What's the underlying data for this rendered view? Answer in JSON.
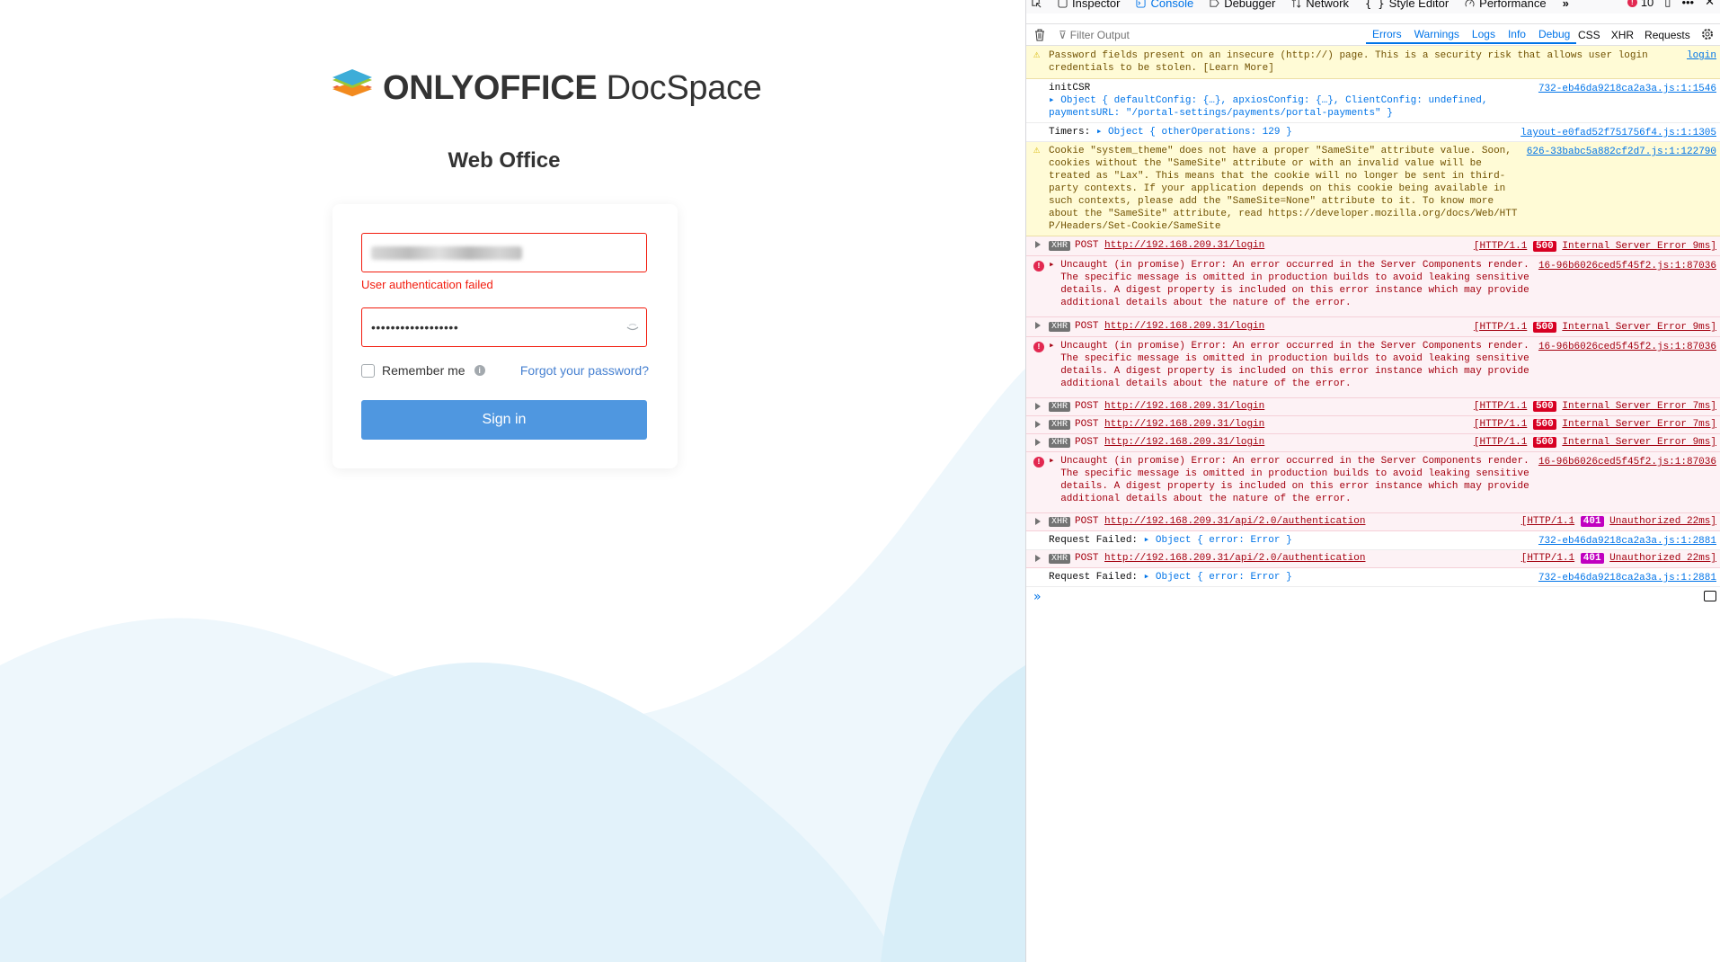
{
  "login": {
    "brand_bold": "ONLYOFFICE",
    "brand_rest": " DocSpace",
    "heading": "Web Office",
    "email_error": "User authentication failed",
    "password_mask": "••••••••••••••••••",
    "remember_label": "Remember me",
    "forgot_link": "Forgot your password?",
    "signin_button": "Sign in",
    "colors": {
      "error": "#f21c0e",
      "primary": "#4f97e0",
      "link": "#4781d1"
    }
  },
  "devtools": {
    "tabs": [
      "Inspector",
      "Console",
      "Debugger",
      "Network",
      "Style Editor",
      "Performance"
    ],
    "active_tab": "Console",
    "error_count": "10",
    "filter_placeholder": "Filter Output",
    "levels": [
      "Errors",
      "Warnings",
      "Logs",
      "Info",
      "Debug"
    ],
    "request_filters": [
      "CSS",
      "XHR",
      "Requests"
    ],
    "messages": {
      "m1": {
        "text": "Password fields present on an insecure (http://) page. This is a security risk that allows user login\ncredentials to be stolen. [Learn More]",
        "source": "login"
      },
      "m2": {
        "line1": "initCSR",
        "line2": "▸ Object { defaultConfig: {…}, apxiosConfig: {…}, ClientConfig: undefined,",
        "line3": "paymentsURL: \"/portal-settings/payments/portal-payments\" }",
        "source": "732-eb46da9218ca2a3a.js:1:1546"
      },
      "m3": {
        "label": "Timers:",
        "obj": "▸ Object { otherOperations: 129 }",
        "source": "layout-e0fad52f751756f4.js:1:1305"
      },
      "m4": {
        "text": "Cookie \"system_theme\" does not have a proper \"SameSite\" attribute value. Soon,\ncookies without the \"SameSite\" attribute or with an invalid value will be\ntreated as \"Lax\". This means that the cookie will no longer be sent in third-\nparty contexts. If your application depends on this cookie being available in\nsuch contexts, please add the \"SameSite=None\" attribute to it. To know more\nabout the \"SameSite\" attribute, read https://developer.mozilla.org/docs/Web/HTT\nP/Headers/Set-Cookie/SameSite",
        "source": "626-33babc5a882cf2d7.js:1:122790"
      },
      "xhr_login_1": {
        "method": "POST",
        "url": "http://192.168.209.31/login",
        "proto": "[HTTP/1.1",
        "status": "500",
        "text": "Internal Server Error 9ms]"
      },
      "err_1": {
        "text": "▸ Uncaught (in promise) Error: An error occurred in the Server Components render.\n  The specific message is omitted in production builds to avoid leaking sensitive\n  details. A digest property is included on this error instance which may provide\n  additional details about the nature of the error.",
        "source": "16-96b6026ced5f45f2.js:1:87036"
      },
      "xhr_login_2": {
        "method": "POST",
        "url": "http://192.168.209.31/login",
        "proto": "[HTTP/1.1",
        "status": "500",
        "text": "Internal Server Error 9ms]"
      },
      "err_2": {
        "text": "▸ Uncaught (in promise) Error: An error occurred in the Server Components render.\n  The specific message is omitted in production builds to avoid leaking sensitive\n  details. A digest property is included on this error instance which may provide\n  additional details about the nature of the error.",
        "source": "16-96b6026ced5f45f2.js:1:87036"
      },
      "xhr_login_3": {
        "method": "POST",
        "url": "http://192.168.209.31/login",
        "proto": "[HTTP/1.1",
        "status": "500",
        "text": "Internal Server Error 7ms]"
      },
      "xhr_login_4": {
        "method": "POST",
        "url": "http://192.168.209.31/login",
        "proto": "[HTTP/1.1",
        "status": "500",
        "text": "Internal Server Error 7ms]"
      },
      "xhr_login_5": {
        "method": "POST",
        "url": "http://192.168.209.31/login",
        "proto": "[HTTP/1.1",
        "status": "500",
        "text": "Internal Server Error 9ms]"
      },
      "err_3": {
        "text": "▸ Uncaught (in promise) Error: An error occurred in the Server Components render.\n  The specific message is omitted in production builds to avoid leaking sensitive\n  details. A digest property is included on this error instance which may provide\n  additional details about the nature of the error.",
        "source": "16-96b6026ced5f45f2.js:1:87036"
      },
      "xhr_auth_1": {
        "method": "POST",
        "url": "http://192.168.209.31/api/2.0/authentication",
        "proto": "[HTTP/1.1",
        "status": "401",
        "text": "Unauthorized 22ms]"
      },
      "req_failed_1": {
        "label": "Request Failed:",
        "obj": "▸ Object { error: Error }",
        "source": "732-eb46da9218ca2a3a.js:1:2881"
      },
      "xhr_auth_2": {
        "method": "POST",
        "url": "http://192.168.209.31/api/2.0/authentication",
        "proto": "[HTTP/1.1",
        "status": "401",
        "text": "Unauthorized 22ms]"
      },
      "req_failed_2": {
        "label": "Request Failed:",
        "obj": "▸ Object { error: Error }",
        "source": "732-eb46da9218ca2a3a.js:1:2881"
      }
    },
    "xhr_label": "XHR",
    "colors": {
      "status_500": "#d70022",
      "status_401": "#c000c0",
      "accent": "#0074e8"
    }
  }
}
